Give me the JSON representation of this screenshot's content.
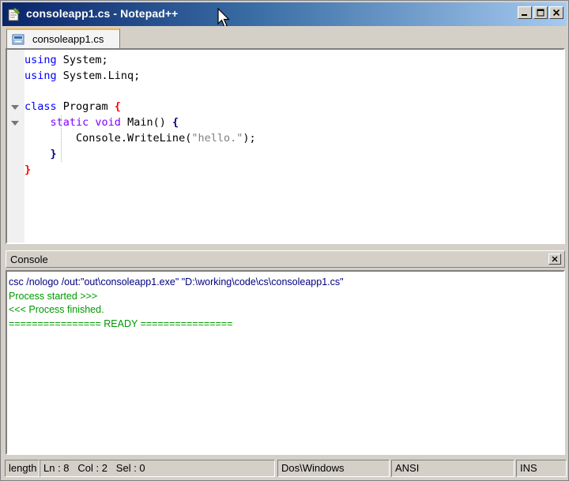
{
  "window": {
    "title": "consoleapp1.cs - Notepad++",
    "icon": "notepadpp-icon"
  },
  "tabs": [
    {
      "label": "consoleapp1.cs",
      "icon": "file-icon"
    }
  ],
  "editor": {
    "lines": [
      {
        "parts": [
          {
            "t": "using",
            "c": "kw"
          },
          {
            "t": " System;",
            "c": "plain"
          }
        ]
      },
      {
        "parts": [
          {
            "t": "using",
            "c": "kw"
          },
          {
            "t": " System.Linq;",
            "c": "plain"
          }
        ]
      },
      {
        "parts": []
      },
      {
        "parts": [
          {
            "t": "class",
            "c": "kw"
          },
          {
            "t": " Program ",
            "c": "plain"
          },
          {
            "t": "{",
            "c": "brace-r"
          }
        ]
      },
      {
        "parts": [
          {
            "t": "    static",
            "c": "kw2"
          },
          {
            "t": " ",
            "c": "plain"
          },
          {
            "t": "void",
            "c": "kw2"
          },
          {
            "t": " Main() ",
            "c": "plain"
          },
          {
            "t": "{",
            "c": "brace-b"
          }
        ]
      },
      {
        "parts": [
          {
            "t": "        Console.WriteLine(",
            "c": "plain"
          },
          {
            "t": "\"hello.\"",
            "c": "str"
          },
          {
            "t": ");",
            "c": "plain"
          }
        ]
      },
      {
        "parts": [
          {
            "t": "    ",
            "c": "plain"
          },
          {
            "t": "}",
            "c": "brace-b"
          }
        ]
      },
      {
        "parts": [
          {
            "t": "}",
            "c": "brace-r"
          }
        ]
      }
    ]
  },
  "console": {
    "title": "Console",
    "lines": [
      {
        "text": "csc /nologo /out:\"out\\consoleapp1.exe\" \"D:\\working\\code\\cs\\consoleapp1.cs\"",
        "kind": "cmd"
      },
      {
        "text": "Process started >>>",
        "kind": "ok"
      },
      {
        "text": "<<< Process finished.",
        "kind": "ok"
      },
      {
        "text": "================ READY ================",
        "kind": "ok"
      }
    ]
  },
  "status": {
    "length": "length",
    "ln": "Ln : 8",
    "col": "Col : 2",
    "sel": "Sel : 0",
    "eol": "Dos\\Windows",
    "encoding": "ANSI",
    "mode": "INS"
  }
}
